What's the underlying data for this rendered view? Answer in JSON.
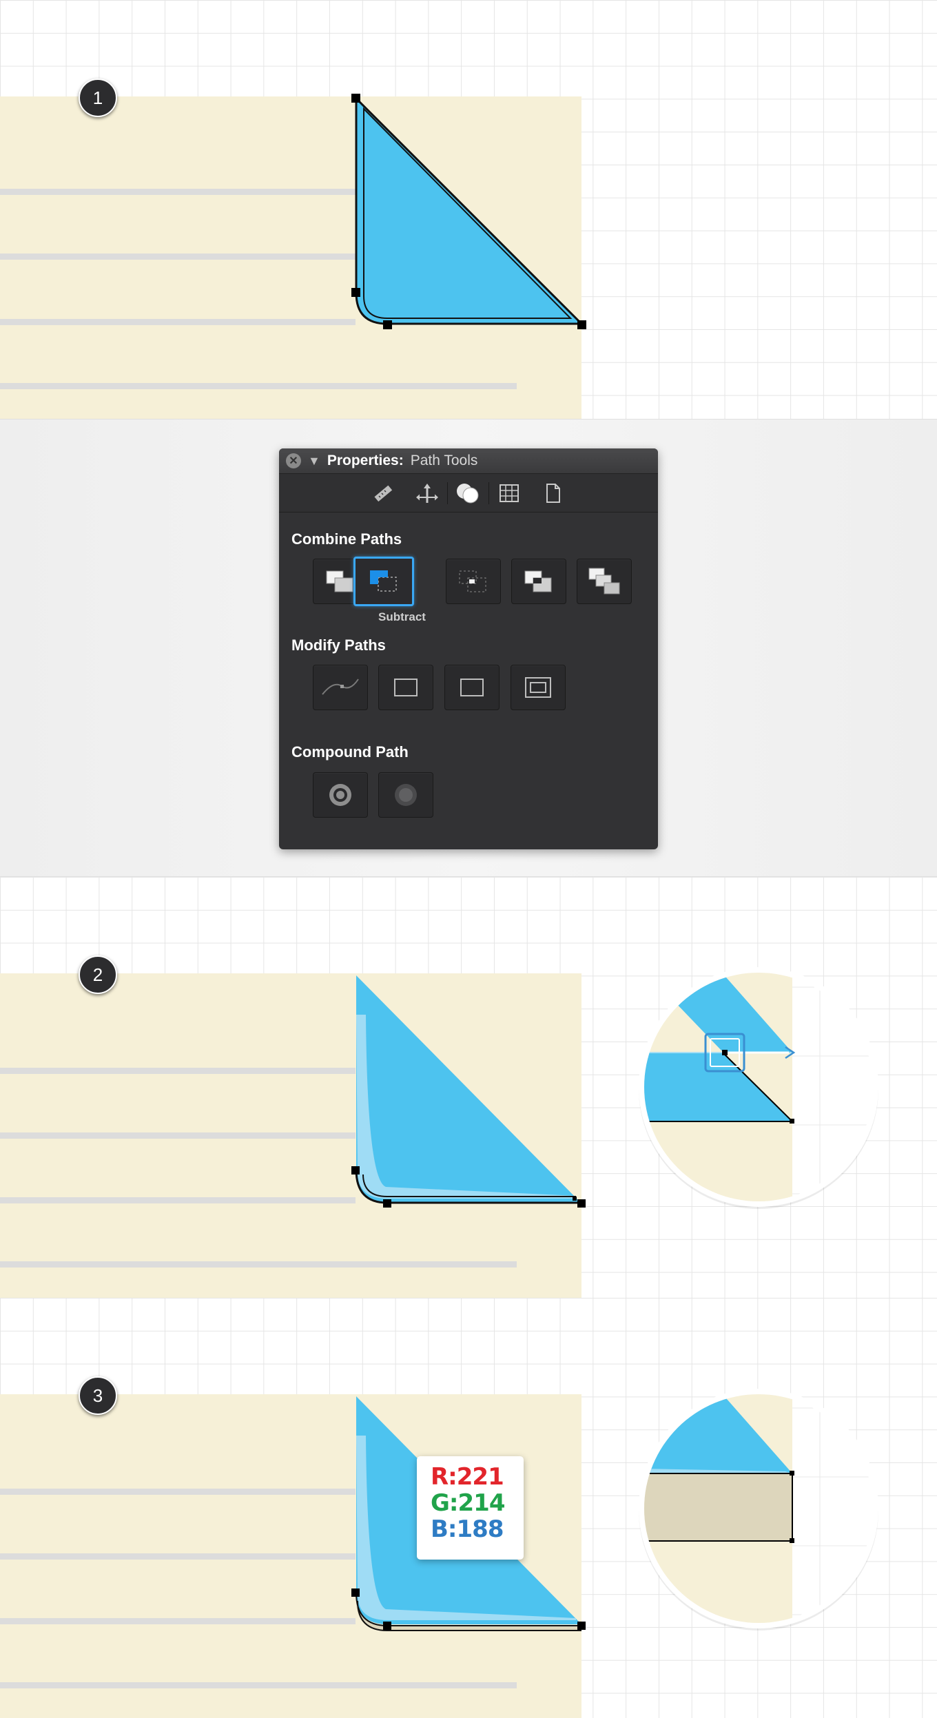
{
  "steps": [
    "1",
    "2",
    "3"
  ],
  "panel": {
    "title_strong": "Properties:",
    "title_value": "Path Tools",
    "toolbar_icons": [
      "ruler-icon",
      "move-arrows-icon",
      "path-tools-icon",
      "grid-icon",
      "document-icon"
    ],
    "combine_label": "Combine Paths",
    "combine_tools": [
      "unite",
      "subtract",
      "intersect",
      "exclude",
      "divide"
    ],
    "selected_tool": "subtract",
    "selected_caption": "Subtract",
    "modify_label": "Modify Paths",
    "modify_tools": [
      "path-curve",
      "rectangle-outline",
      "rectangle-outline-2",
      "rectangle-inset"
    ],
    "compound_label": "Compound Path",
    "compound_tools": [
      "make-compound",
      "release-compound"
    ]
  },
  "color_readout": {
    "r": "R:221",
    "g": "G:214",
    "b": "B:188"
  },
  "colors": {
    "paper": "#f6f0d7",
    "stripe": "#dcdcdc",
    "triangle_blue": "#4dc3ef",
    "highlight_blue": "#9fdcf5",
    "fill_beige": "#ddd6bc",
    "panel_bg": "#323234",
    "accent": "#3aa8f5",
    "r": "#e2252b",
    "g": "#20a34a",
    "b": "#2e7cc4"
  }
}
